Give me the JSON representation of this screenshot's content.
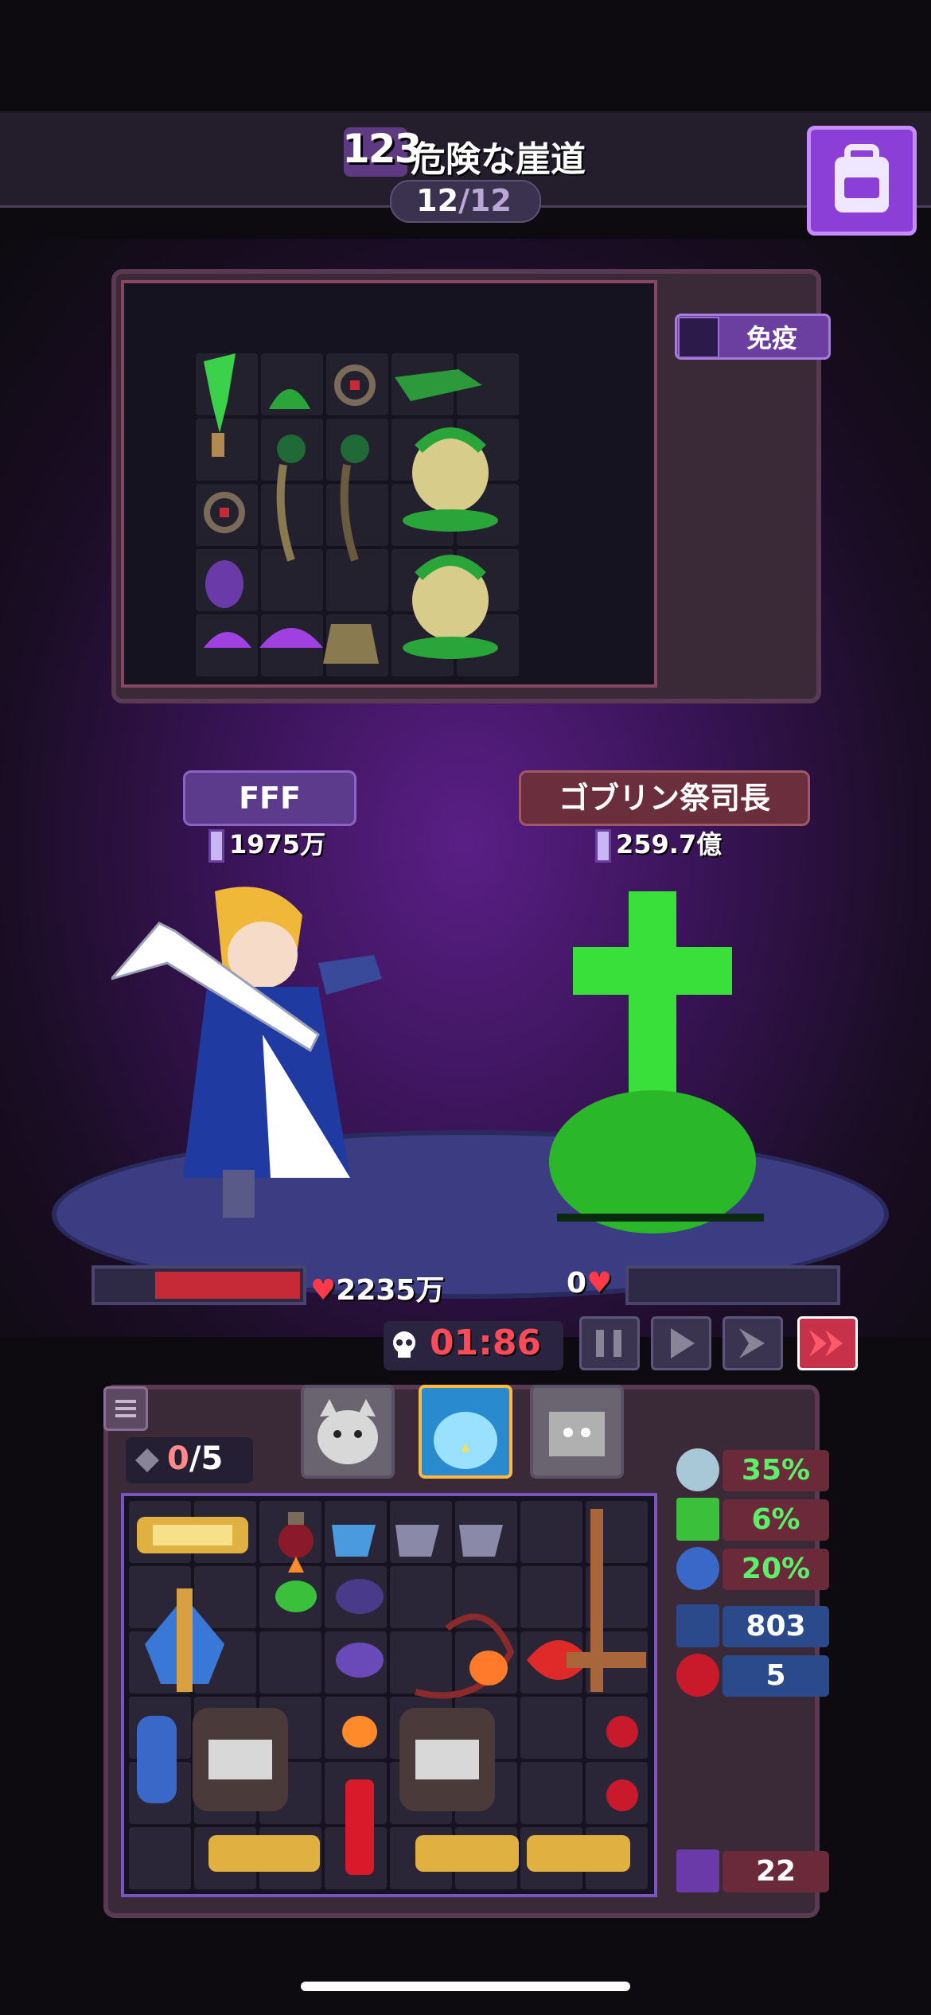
{
  "header": {
    "stage_number": "123",
    "stage_title": "危険な崖道",
    "wave_current": "12",
    "wave_total": "/12",
    "bag_icon": "backpack-icon"
  },
  "enemy_board": {
    "immune_label": "免疫"
  },
  "player": {
    "name": "FFF",
    "power": "1975万",
    "hp": "2235万",
    "hp_fraction": 0.6
  },
  "enemy": {
    "name": "ゴブリン祭司長",
    "power": "259.7億",
    "hp": "0",
    "hp_fraction": 0
  },
  "battle": {
    "timer": "01:86",
    "controls": [
      "pause-icon",
      "play-icon",
      "fast-forward-icon",
      "double-speed-icon"
    ],
    "active_control": "double-speed-icon"
  },
  "inventory": {
    "gem_count": "0",
    "gem_max": "/5"
  },
  "stats": {
    "defense_pct": "35%",
    "heal_pct": "6%",
    "evade_pct": "20%",
    "crit": "803",
    "vamp": "5",
    "monster_count": "22"
  },
  "colors": {
    "accent_purple": "#8b3fd6",
    "hp_red": "#c52a36",
    "timer_red": "#ff4a5a",
    "stat_green": "#5cf06a"
  }
}
